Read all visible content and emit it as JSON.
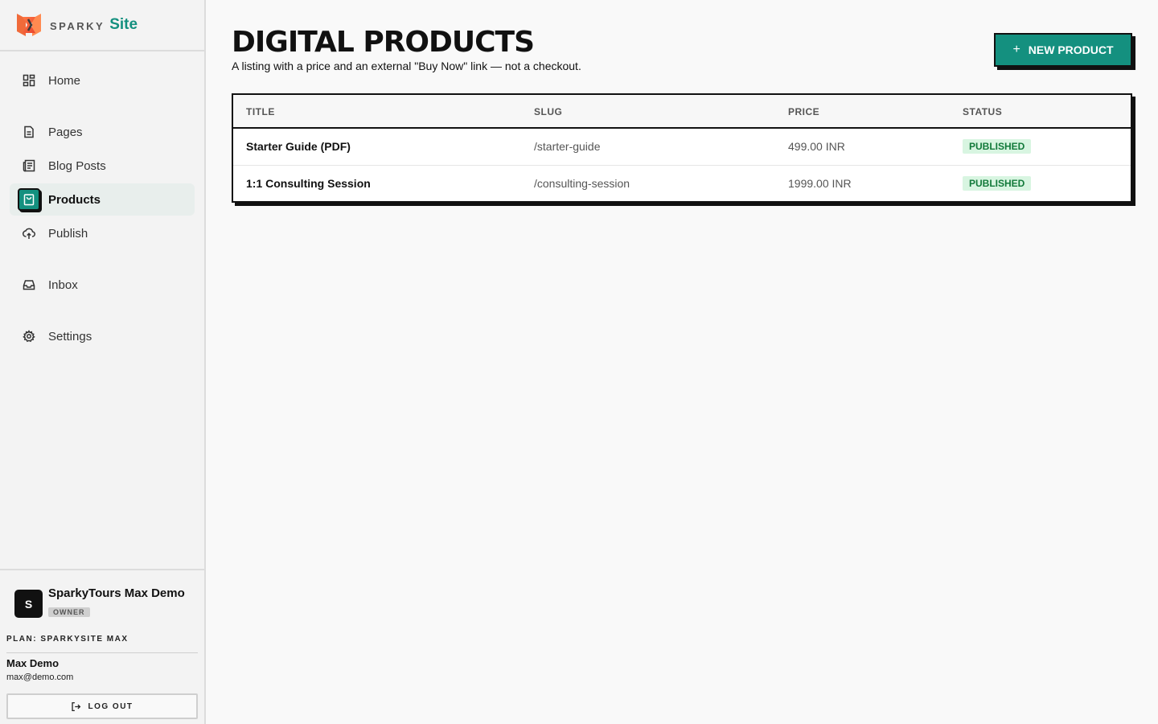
{
  "brand": {
    "sparky": "SPARKY",
    "site": "Site"
  },
  "sidebar": {
    "items": [
      {
        "label": "Home",
        "icon": "home-grid-icon"
      },
      {
        "label": "Pages",
        "icon": "page-icon"
      },
      {
        "label": "Blog Posts",
        "icon": "blog-icon"
      },
      {
        "label": "Products",
        "icon": "shopping-bag-icon",
        "active": true
      },
      {
        "label": "Publish",
        "icon": "cloud-upload-icon"
      },
      {
        "label": "Inbox",
        "icon": "inbox-icon"
      },
      {
        "label": "Settings",
        "icon": "gear-icon"
      }
    ]
  },
  "account": {
    "avatar": "S",
    "name": "SparkyTours Max Demo",
    "role": "OWNER",
    "plan": "PLAN: SPARKYSITE MAX",
    "user_name": "Max Demo",
    "user_email": "max@demo.com",
    "logout_label": "LOG OUT"
  },
  "main": {
    "title": "DIGITAL PRODUCTS",
    "subtitle": "A listing with a price and an external \"Buy Now\" link — not a checkout.",
    "new_button": {
      "plus": "+",
      "label": "NEW PRODUCT"
    }
  },
  "table": {
    "headers": [
      "TITLE",
      "SLUG",
      "PRICE",
      "STATUS"
    ],
    "rows": [
      {
        "title": "Starter Guide (PDF)",
        "slug": "/starter-guide",
        "price": "499.00 INR",
        "status": "PUBLISHED"
      },
      {
        "title": "1:1 Consulting Session",
        "slug": "/consulting-session",
        "price": "1999.00 INR",
        "status": "PUBLISHED"
      }
    ]
  },
  "colors": {
    "accent": "#14907f",
    "badge_bg": "#d8f5e1",
    "badge_text": "#127a3a"
  }
}
